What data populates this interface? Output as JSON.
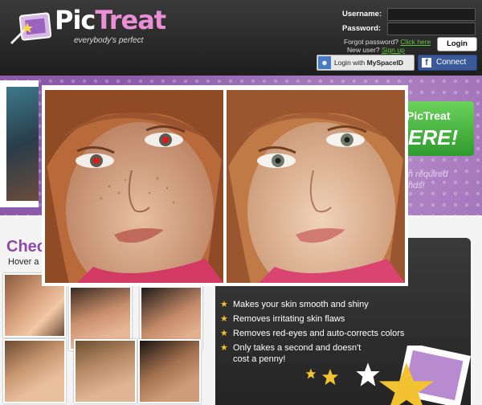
{
  "header": {
    "logo_pic": "Pic",
    "logo_treat": "Treat",
    "tagline": "everybody's perfect",
    "username_label": "Username:",
    "password_label": "Password:",
    "forgot_text": "Forgot password?",
    "forgot_link": "Click here",
    "newuser_text": "New user?",
    "signup_link": "Sign up",
    "login_label": "Login",
    "myspace_prefix": "Login with ",
    "myspace_label": "MySpaceID",
    "facebook_label": "Connect"
  },
  "hero": {
    "sticker_brand": "PicTreat",
    "sticker_text": "ERE!",
    "note_line1": "n required",
    "note_line2": "nds!"
  },
  "section": {
    "title": "Chec",
    "hover_text": "Hover a"
  },
  "features": [
    "Makes your skin smooth and shiny",
    "Removes irritating skin flaws",
    "Removes red-eyes and auto-corrects colors",
    "Only takes a second and doesn't",
    "cost a penny!"
  ],
  "colors": {
    "accent_purple": "#8e48a8",
    "brand_pink": "#e98fd6",
    "link_green": "#5fc63a",
    "facebook_blue": "#3b5998"
  }
}
